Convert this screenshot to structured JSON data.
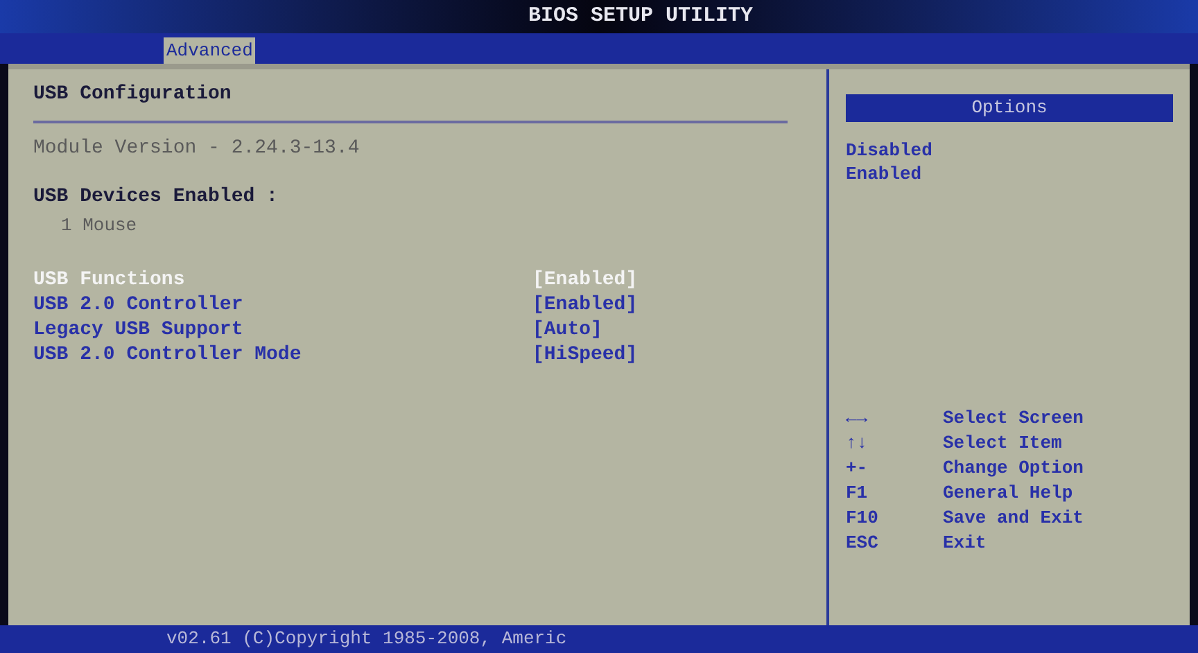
{
  "title": "BIOS SETUP UTILITY",
  "tabs": [
    {
      "label": "Advanced",
      "selected": true
    }
  ],
  "panel": {
    "title": "USB Configuration",
    "module_version": "Module Version - 2.24.3-13.4",
    "devices_heading": "USB Devices Enabled :",
    "devices": [
      "1 Mouse"
    ],
    "settings": [
      {
        "label": "USB Functions",
        "value": "[Enabled]",
        "selected": true
      },
      {
        "label": "USB 2.0 Controller",
        "value": "[Enabled]",
        "selected": false
      },
      {
        "label": "Legacy USB Support",
        "value": "[Auto]",
        "selected": false
      },
      {
        "label": "USB 2.0 Controller Mode",
        "value": "[HiSpeed]",
        "selected": false
      }
    ]
  },
  "options": {
    "title": "Options",
    "items": [
      "Disabled",
      "Enabled"
    ]
  },
  "help": [
    {
      "key": "←→",
      "action": "Select Screen"
    },
    {
      "key": "↑↓",
      "action": "Select Item"
    },
    {
      "key": "+-",
      "action": "Change Option"
    },
    {
      "key": "F1",
      "action": "General Help"
    },
    {
      "key": "F10",
      "action": "Save and Exit"
    },
    {
      "key": "ESC",
      "action": "Exit"
    }
  ],
  "footer": "v02.61 (C)Copyright 1985-2008, Americ"
}
